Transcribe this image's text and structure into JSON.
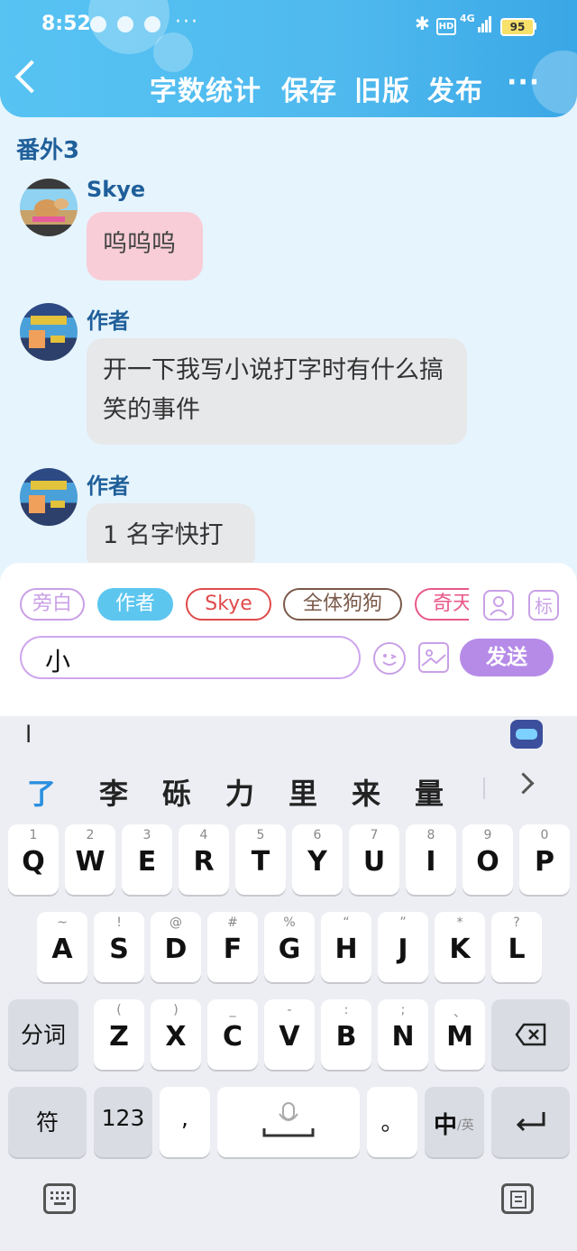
{
  "status_bar": {
    "time": "8:52",
    "more": "···",
    "hd": "HD",
    "network": "4G",
    "battery": "95"
  },
  "header": {
    "back_icon": "chevron-left-icon",
    "buttons": [
      "字数统计",
      "保存",
      "旧版",
      "发布"
    ],
    "more": "···",
    "colors": {
      "gradient_start": "#57c3f3",
      "gradient_end": "#3aa7e6"
    }
  },
  "chapter_title": "番外3",
  "messages": [
    {
      "name": "Skye",
      "text": "呜呜呜",
      "bubble_color": "#f8cdd7"
    },
    {
      "name": "作者",
      "text": "开一下我写小说打字时有什么搞笑的事件",
      "bubble_color": "#e7e8ea"
    },
    {
      "name": "作者",
      "text": "1 名字快打",
      "bubble_color": "#e7e8ea"
    }
  ],
  "characters": [
    {
      "label": "旁白",
      "color": "#c9a0e6"
    },
    {
      "label": "作者",
      "color": "#5cc6ef"
    },
    {
      "label": "Skye",
      "color": "#e04a4a"
    },
    {
      "label": "全体狗狗",
      "color": "#7a5a4a"
    },
    {
      "label": "奇天",
      "color": "#e8588a"
    }
  ],
  "tool_icons": {
    "person_icon": "person-card-icon",
    "tag": "标"
  },
  "input": {
    "value": "小",
    "send": "发送"
  },
  "keyboard": {
    "pinyin": "l",
    "candidates": [
      "了",
      "李",
      "砾",
      "力",
      "里",
      "来",
      "量"
    ],
    "row1": [
      [
        "1",
        "Q"
      ],
      [
        "2",
        "W"
      ],
      [
        "3",
        "E"
      ],
      [
        "4",
        "R"
      ],
      [
        "5",
        "T"
      ],
      [
        "6",
        "Y"
      ],
      [
        "7",
        "U"
      ],
      [
        "8",
        "I"
      ],
      [
        "9",
        "O"
      ],
      [
        "0",
        "P"
      ]
    ],
    "row2": [
      [
        "~",
        "A"
      ],
      [
        "!",
        "S"
      ],
      [
        "@",
        "D"
      ],
      [
        "#",
        "F"
      ],
      [
        "%",
        "G"
      ],
      [
        "“",
        "H"
      ],
      [
        "”",
        "J"
      ],
      [
        "*",
        "K"
      ],
      [
        "?",
        "L"
      ]
    ],
    "row3": [
      [
        "(",
        "Z"
      ],
      [
        ")",
        "X"
      ],
      [
        "_",
        "C"
      ],
      [
        "-",
        "V"
      ],
      [
        ":",
        "B"
      ],
      [
        ";",
        "N"
      ],
      [
        "、",
        "M"
      ]
    ],
    "row3_left": "分词",
    "row4_left": "符",
    "row4_num": "123",
    "comma": ",",
    "period": "。",
    "lang_main": "中",
    "lang_sub": "/英"
  }
}
